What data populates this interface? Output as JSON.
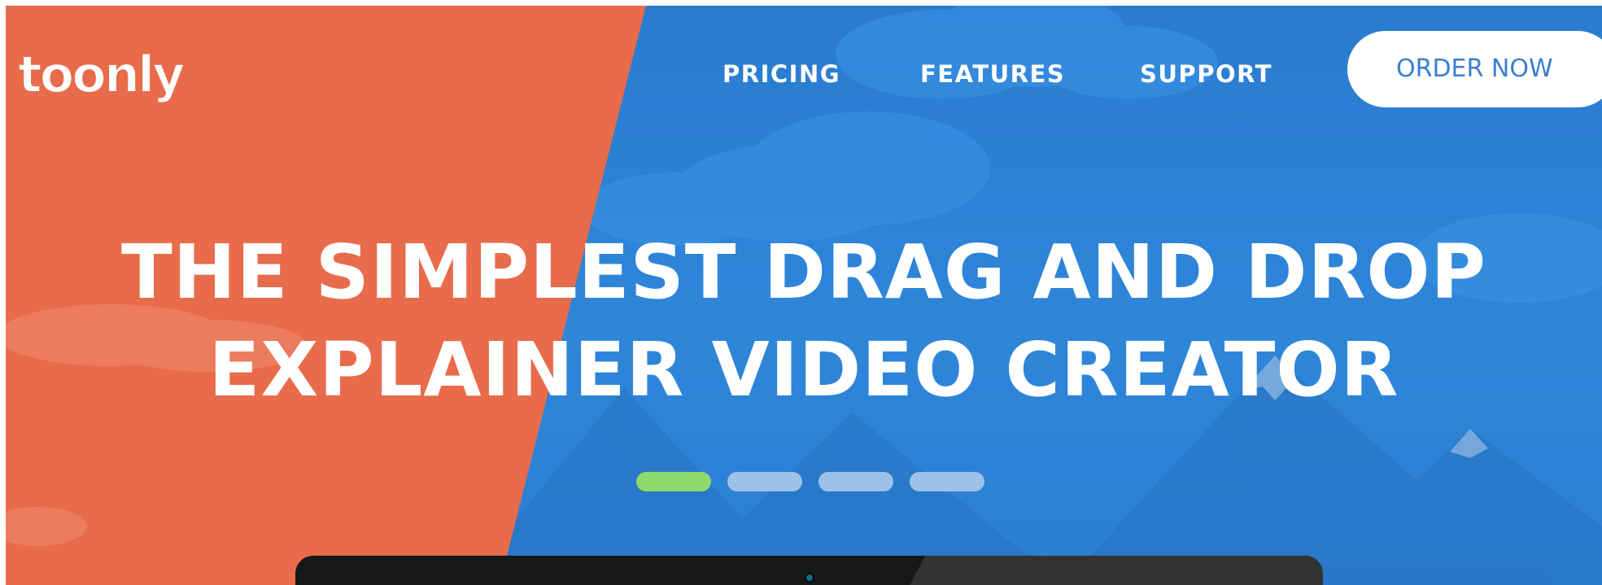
{
  "brand": {
    "logo_text": "toonly",
    "colors": {
      "orange": "#e86b4b",
      "blue": "#2d7fd2",
      "white": "#ffffff",
      "order_text": "#3a7fd0"
    }
  },
  "nav": {
    "links": [
      {
        "label": "PRICING"
      },
      {
        "label": "FEATURES"
      },
      {
        "label": "SUPPORT"
      }
    ],
    "cta_label": "ORDER NOW"
  },
  "hero": {
    "headline_line1": "THE SIMPLEST DRAG AND DROP",
    "headline_line2": "EXPLAINER VIDEO CREATOR",
    "carousel": {
      "slide_count": 4,
      "active_index": 0,
      "active_color": "#8fd86a",
      "inactive_color": "#9dc2e8"
    }
  }
}
